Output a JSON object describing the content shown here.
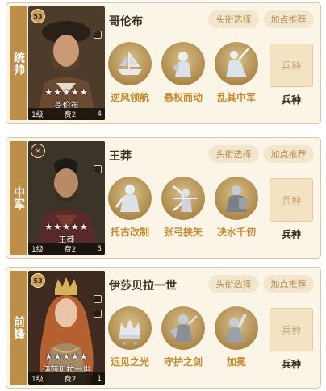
{
  "colors": {
    "card_bg": "#fbf5e8",
    "role_tab": "#bd8e47",
    "skill_label": "#c88a2a",
    "pill_bg": "#f3e6cf",
    "pill_text": "#b38c4c"
  },
  "icons": [
    "gold-coin-badge-icon",
    "crossed-swords-badge-icon",
    "ship-icon",
    "knight-icon",
    "warrior-icon",
    "archer-icon",
    "shield-warrior-icon",
    "crown-icon",
    "sword-guard-icon",
    "arm-raise-icon"
  ],
  "generals": [
    {
      "role": "统帅",
      "name": "哥伦布",
      "portrait_name": "哥伦布",
      "badge": "53",
      "stars": "★★★★★",
      "level": "1级",
      "cost": "费2",
      "count": "4",
      "title_button": "头衔选择",
      "points_button": "加点推荐",
      "skills": [
        {
          "label": "逆风领航",
          "icon": "ship-icon"
        },
        {
          "label": "悬权而动",
          "icon": "knight-icon"
        },
        {
          "label": "乱其中军",
          "icon": "warrior-icon"
        }
      ],
      "troop_slot": "兵种",
      "troop_label": "兵种"
    },
    {
      "role": "中军",
      "name": "王莽",
      "portrait_name": "王莽",
      "badge": "",
      "stars": "★★★★★",
      "level": "1级",
      "cost": "费2",
      "count": "3",
      "title_button": "头衔选择",
      "points_button": "加点推荐",
      "skills": [
        {
          "label": "托古改制",
          "icon": "warrior-icon"
        },
        {
          "label": "张弓挟矢",
          "icon": "archer-icon"
        },
        {
          "label": "决水千仞",
          "icon": "shield-warrior-icon"
        }
      ],
      "troop_slot": "兵种",
      "troop_label": "兵种"
    },
    {
      "role": "前锋",
      "name": "伊莎贝拉一世",
      "portrait_name": "伊莎贝拉一世",
      "badge": "53",
      "stars": "★★★★★",
      "level": "1级",
      "cost": "费2",
      "count": "1",
      "title_button": "头衔选择",
      "points_button": "加点推荐",
      "skills": [
        {
          "label": "远见之光",
          "icon": "crown-icon"
        },
        {
          "label": "守护之剑",
          "icon": "sword-guard-icon"
        },
        {
          "label": "加冕",
          "icon": "arm-raise-icon"
        }
      ],
      "troop_slot": "兵种",
      "troop_label": "兵种"
    }
  ]
}
